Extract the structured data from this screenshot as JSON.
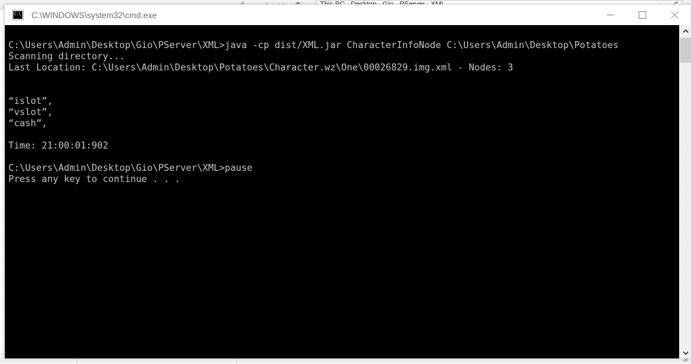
{
  "explorer": {
    "name": "file-explorer-window",
    "nav": {
      "back_icon": "arrow-left-icon",
      "forward_icon": "arrow-right-icon",
      "recent_icon": "chevron-down-icon",
      "up_icon": "arrow-up-icon"
    },
    "breadcrumb": {
      "separator": "›",
      "items": [
        "This PC",
        "Desktop",
        "Gio",
        "PServer",
        "XML"
      ]
    },
    "address_buttons": {
      "history_icon": "chevron-down-icon",
      "refresh_icon": "refresh-icon"
    }
  },
  "cmd": {
    "title": "C:\\WINDOWS\\system32\\cmd.exe",
    "icon_name": "cmd-console-icon",
    "icon_text": "C:\\",
    "window_controls": {
      "minimize_label": "Minimize",
      "maximize_label": "Maximize",
      "close_label": "Close"
    },
    "scrollbar": {
      "up_arrow": "⌃",
      "down_arrow": "⌄"
    },
    "colors": {
      "background": "#000000",
      "text": "#c3c3c3",
      "titlebar": "#ffffff",
      "title_text": "#6d6d6d"
    },
    "console_output": "C:\\Users\\Admin\\Desktop\\Gio\\PServer\\XML>java -cp dist/XML.jar CharacterInfoNode C:\\Users\\Admin\\Desktop\\Potatoes\nScanning directory...\nLast Location: C:\\Users\\Admin\\Desktop\\Potatoes\\Character.wz\\One\\00026829.img.xml - Nodes: 3\n\n\n“islot”,\n“vslot”,\n“cash”,\n\nTime: 21:00:01:902\n\nC:\\Users\\Admin\\Desktop\\Gio\\PServer\\XML>pause\nPress any key to continue . . ."
  }
}
